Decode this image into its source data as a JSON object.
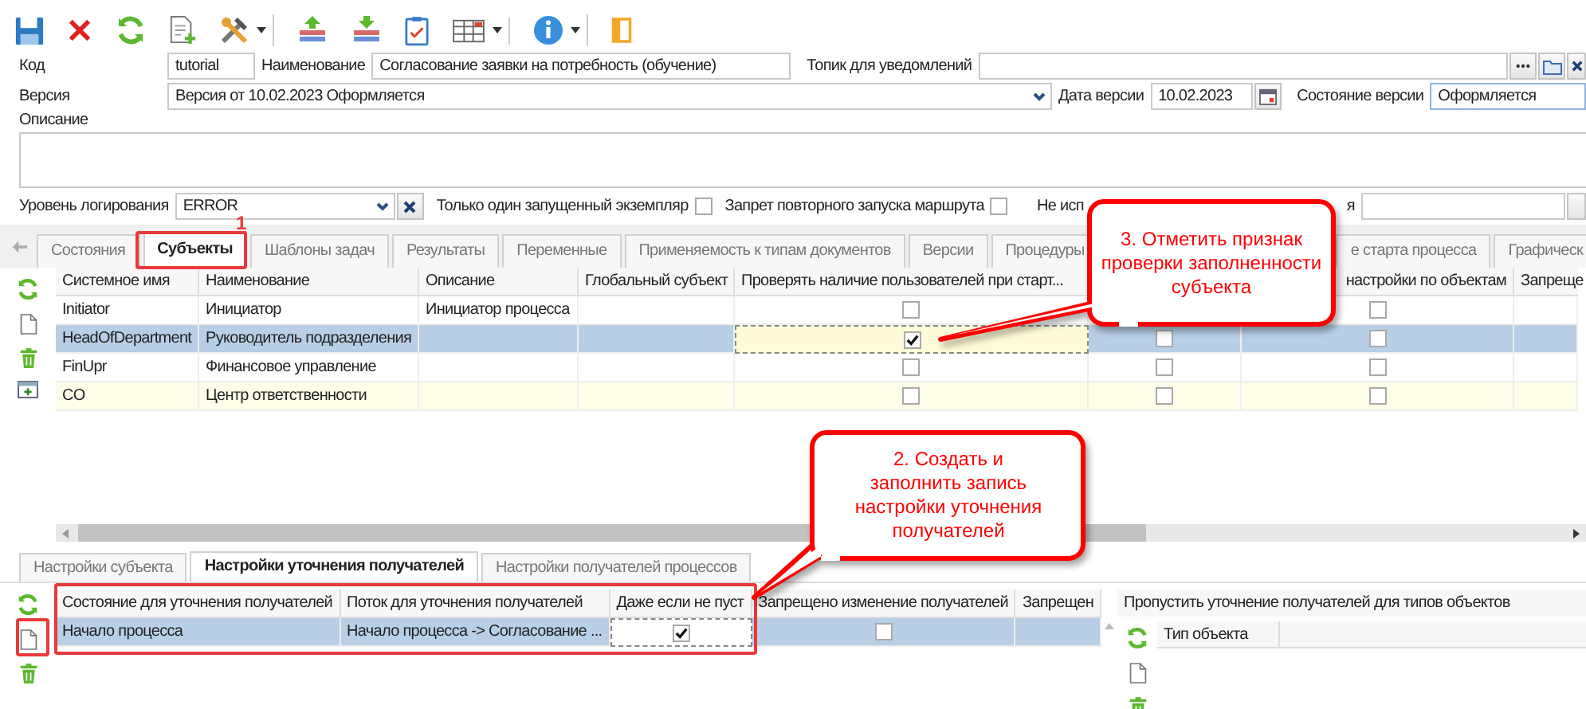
{
  "form": {
    "code": {
      "label": "Код",
      "value": "tutorial"
    },
    "name": {
      "label": "Наименование",
      "value": "Согласование заявки на потребность (обучение)"
    },
    "topic": {
      "label": "Топик для уведомлений"
    },
    "version": {
      "label": "Версия",
      "value": "Версия от 10.02.2023 Оформляется"
    },
    "version_date": {
      "label": "Дата версии",
      "value": "10.02.2023"
    },
    "version_state": {
      "label": "Состояние версии",
      "value": "Оформляется"
    },
    "description": {
      "label": "Описание"
    },
    "log_level": {
      "label": "Уровень логирования",
      "value": "ERROR"
    },
    "options": [
      {
        "label": "Только один запущенный экземпляр",
        "checked": false
      },
      {
        "label": "Запрет повторного запуска маршрута",
        "checked": false
      }
    ],
    "covered_option": {
      "label_start": "Не исп",
      "label_end": "я"
    }
  },
  "main_tabs": [
    {
      "label": "Состояния",
      "selected": false
    },
    {
      "label": "Субъекты",
      "selected": true
    },
    {
      "label": "Шаблоны задач",
      "selected": false
    },
    {
      "label": "Результаты",
      "selected": false
    },
    {
      "label": "Переменные",
      "selected": false
    },
    {
      "label": "Применяемость к типам документов",
      "selected": false
    },
    {
      "label": "Версии",
      "selected": false
    },
    {
      "label": "Процедуры",
      "selected": false
    },
    {
      "label": "е старта процесса",
      "selected": false
    },
    {
      "label": "Графическ",
      "selected": false
    }
  ],
  "subjects_table": {
    "columns": [
      {
        "kind": "text",
        "title": "Системное имя"
      },
      {
        "kind": "text",
        "title": "Наименование"
      },
      {
        "kind": "text",
        "title": "Описание"
      },
      {
        "kind": "text",
        "title": "Глобальный субъект"
      },
      {
        "kind": "check",
        "title": "Проверять наличие пользователей при старт..."
      },
      {
        "kind": "check"
      },
      {
        "kind": "check",
        "title": "настройки по объектам"
      },
      {
        "kind": "text",
        "title": "Запреще"
      }
    ],
    "rows": [
      {
        "system_name": "Initiator",
        "name": "Инициатор",
        "description": "Инициатор процесса",
        "check_users": false,
        "object_settings": false,
        "selected": false,
        "focused": false,
        "hovered": false
      },
      {
        "system_name": "HeadOfDepartment",
        "name": "Руководитель подразделения",
        "check_users": true,
        "column_6": false,
        "object_settings": false,
        "selected": true,
        "focused": true,
        "hovered": false
      },
      {
        "system_name": "FinUpr",
        "name": "Финансовое управление",
        "check_users": false,
        "column_6": false,
        "object_settings": false,
        "selected": false,
        "focused": false,
        "hovered": false
      },
      {
        "system_name": "CO",
        "name": "Центр ответственности",
        "check_users": false,
        "column_6": false,
        "object_settings": false,
        "selected": false,
        "focused": false,
        "hovered": true
      }
    ]
  },
  "detail_tabs": [
    {
      "label": "Настройки субъекта",
      "selected": false
    },
    {
      "label": "Настройки уточнения получателей",
      "selected": true
    },
    {
      "label": "Настройки получателей процессов",
      "selected": false
    }
  ],
  "recipients_table": {
    "columns": [
      {
        "kind": "text",
        "title": "Состояние для уточнения получателей"
      },
      {
        "kind": "text",
        "title": "Поток для уточнения получателей"
      },
      {
        "kind": "check",
        "title": "Даже если не пуст"
      },
      {
        "kind": "check",
        "title": "Запрещено изменение получателей"
      },
      {
        "kind": "text",
        "title": "Запрещен"
      }
    ],
    "rows": [
      {
        "state": "Начало процесса",
        "flow": "Начало процесса -> Согласование ...",
        "even_if_not_empty": true,
        "change_forbidden": false,
        "selected": true,
        "focused": true
      }
    ]
  },
  "skip_panel": {
    "title": "Пропустить уточнение получателей для типов объектов",
    "columns": [
      "Тип объекта"
    ]
  },
  "annotations": {
    "marker": "1",
    "callouts": [
      {
        "text": "3. Отметить признак проверки заполненности субъекта"
      },
      {
        "text": "2. Создать и заполнить запись настройки уточнения получателей"
      }
    ]
  }
}
